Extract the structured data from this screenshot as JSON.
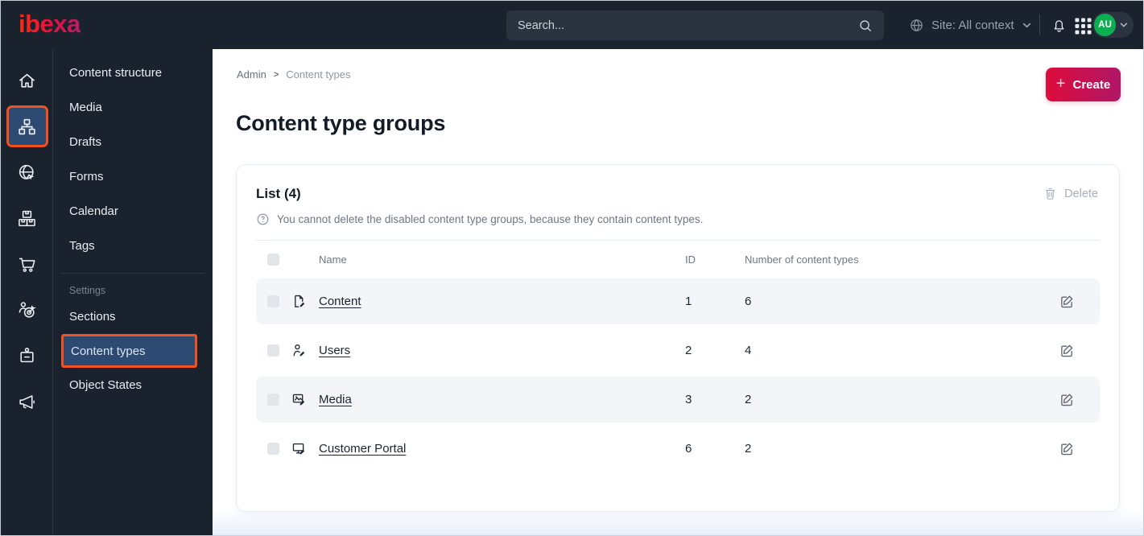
{
  "topbar": {
    "logo": "ibexa",
    "search_placeholder": "Search...",
    "site_selector": "Site: All context",
    "avatar_initials": "AU"
  },
  "icon_sidebar": {
    "icons": [
      "home-icon",
      "sitemap-icon",
      "site-globe-icon",
      "products-boxes-icon",
      "cart-icon",
      "personalization-target-icon",
      "id-badge-icon",
      "megaphone-icon"
    ],
    "selected_index": 1
  },
  "sidebar": {
    "items": [
      "Content structure",
      "Media",
      "Drafts",
      "Forms",
      "Calendar",
      "Tags"
    ],
    "settings_label": "Settings",
    "settings_items": [
      "Sections",
      "Content types",
      "Object States"
    ],
    "selected_item": "Content types"
  },
  "breadcrumb": {
    "root": "Admin",
    "current": "Content types"
  },
  "page": {
    "title": "Content type groups",
    "create_label": "Create"
  },
  "list": {
    "title": "List (4)",
    "info": "You cannot delete the disabled content type groups, because they contain content types.",
    "delete_label": "Delete",
    "columns": {
      "name": "Name",
      "id": "ID",
      "count": "Number of content types"
    },
    "rows": [
      {
        "name": "Content",
        "id": "1",
        "count": "6",
        "icon": "file-edit-icon"
      },
      {
        "name": "Users",
        "id": "2",
        "count": "4",
        "icon": "user-edit-icon"
      },
      {
        "name": "Media",
        "id": "3",
        "count": "2",
        "icon": "image-edit-icon"
      },
      {
        "name": "Customer Portal",
        "id": "6",
        "count": "2",
        "icon": "monitor-edit-icon"
      }
    ]
  },
  "colors": {
    "topbar_bg": "#1a222e",
    "accent_orange": "#f3511d",
    "selected_blue": "#2c4a72",
    "create_gradient_start": "#dd0c3b",
    "create_gradient_end": "#b01767",
    "avatar_green": "#0cae51",
    "row_stripe": "#f4f5f8"
  }
}
